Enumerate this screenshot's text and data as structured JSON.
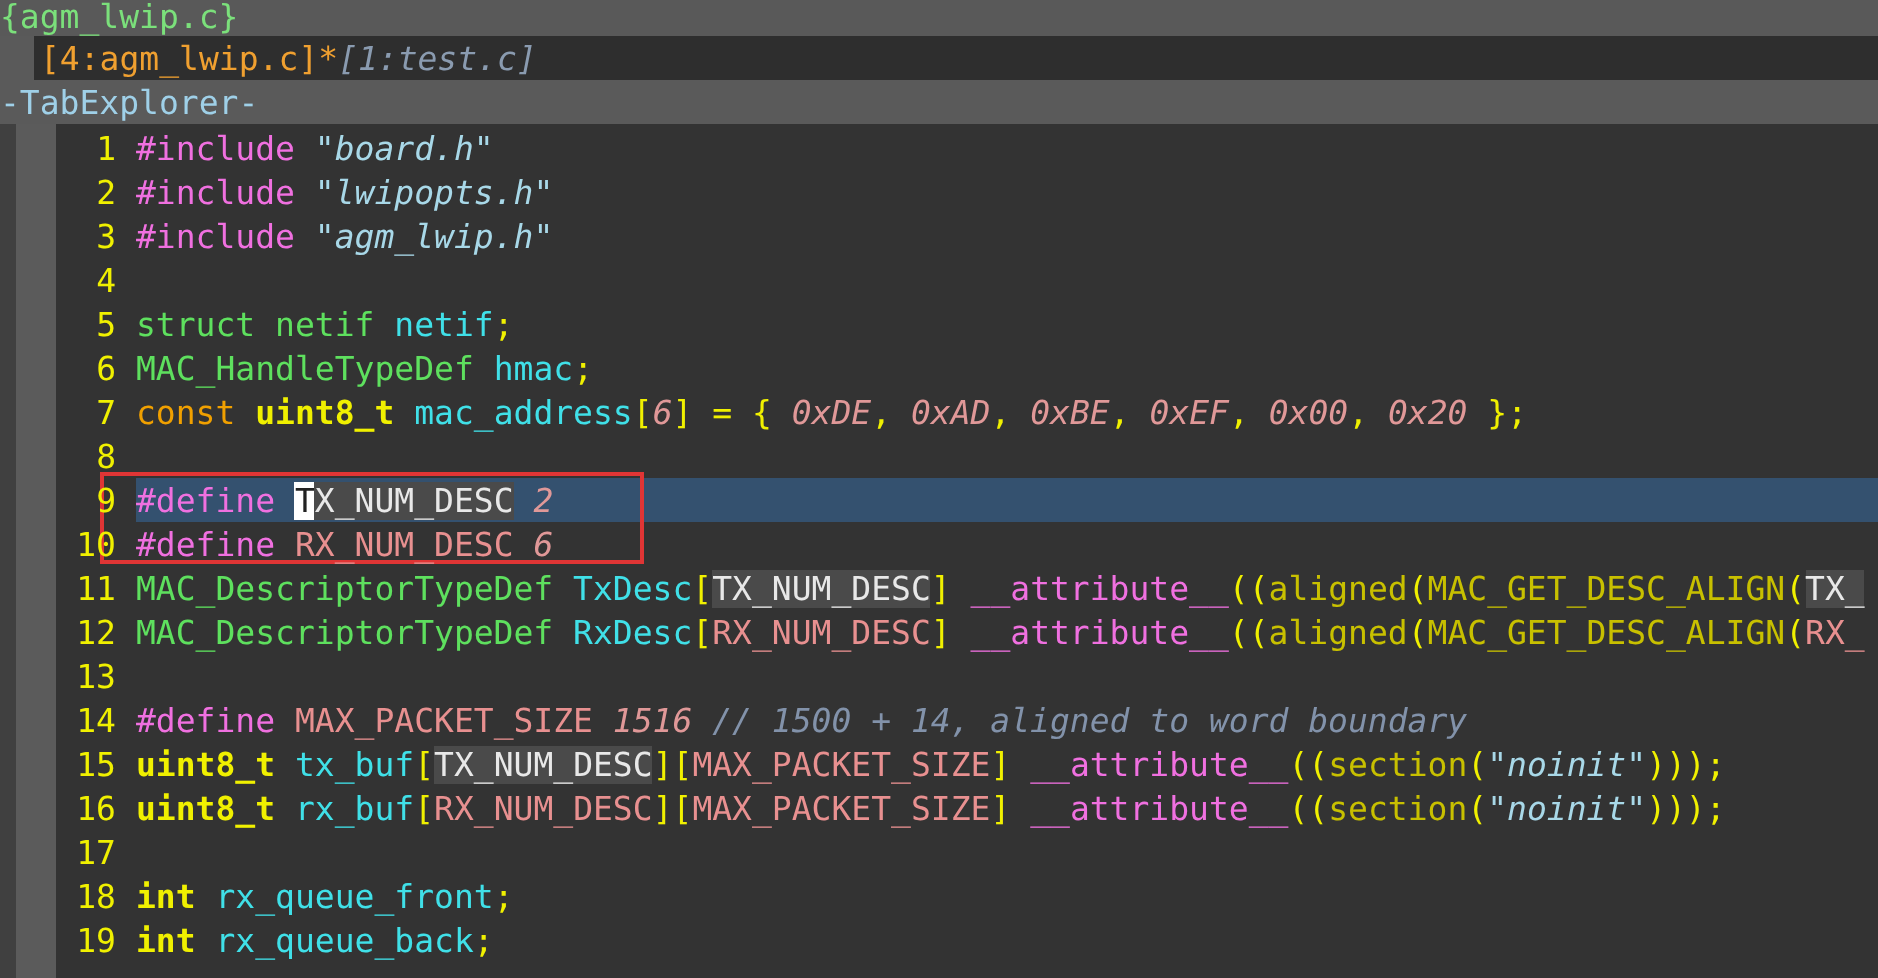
{
  "header": {
    "title": "{agm_lwip.c}"
  },
  "tabs": [
    {
      "label": "[4:agm_lwip.c]",
      "selected": true,
      "modified_mark": "*"
    },
    {
      "label": "[1:test.c]",
      "selected": false
    }
  ],
  "explorer": {
    "title": "-TabExplorer-"
  },
  "editor": {
    "lines": [
      {
        "number": "1",
        "current": false,
        "tokens": [
          {
            "text": "#include",
            "kind": "preproc"
          },
          {
            "text": " \"board.h\"",
            "kind": "string"
          }
        ]
      },
      {
        "number": "2",
        "current": false,
        "tokens": [
          {
            "text": "#include",
            "kind": "preproc"
          },
          {
            "text": " \"lwipopts.h\"",
            "kind": "string"
          }
        ]
      },
      {
        "number": "3",
        "current": false,
        "tokens": [
          {
            "text": "#include",
            "kind": "preproc"
          },
          {
            "text": " \"agm_lwip.h\"",
            "kind": "string"
          }
        ]
      },
      {
        "number": "4",
        "current": false
      },
      {
        "number": "5",
        "current": false,
        "tokens": [
          {
            "text": "struct netif",
            "kind": "type"
          },
          {
            "text": " netif",
            "kind": "ident"
          },
          {
            "text": ";",
            "kind": "punct"
          }
        ]
      },
      {
        "number": "6",
        "current": false,
        "tokens": [
          {
            "text": "MAC_HandleTypeDef",
            "kind": "type"
          },
          {
            "text": " hmac",
            "kind": "ident"
          },
          {
            "text": ";",
            "kind": "punct"
          }
        ]
      },
      {
        "number": "7",
        "current": false,
        "tokens": [
          {
            "text": "const",
            "kind": "keyword"
          },
          {
            "text": " uint8_t",
            "kind": "builtin"
          },
          {
            "text": " mac_address",
            "kind": "ident"
          },
          {
            "text": "[",
            "kind": "punct"
          },
          {
            "text": "6",
            "kind": "number"
          },
          {
            "text": "] = { ",
            "kind": "punct"
          },
          {
            "text": "0xDE",
            "kind": "number"
          },
          {
            "text": ", ",
            "kind": "punct"
          },
          {
            "text": "0xAD",
            "kind": "number"
          },
          {
            "text": ", ",
            "kind": "punct"
          },
          {
            "text": "0xBE",
            "kind": "number"
          },
          {
            "text": ", ",
            "kind": "punct"
          },
          {
            "text": "0xEF",
            "kind": "number"
          },
          {
            "text": ", ",
            "kind": "punct"
          },
          {
            "text": "0x00",
            "kind": "number"
          },
          {
            "text": ", ",
            "kind": "punct"
          },
          {
            "text": "0x20",
            "kind": "number"
          },
          {
            "text": " };",
            "kind": "punct"
          }
        ]
      },
      {
        "number": "8",
        "current": false
      },
      {
        "number": "9",
        "current": true,
        "tokens": [
          {
            "text": "#define ",
            "kind": "preproc"
          },
          {
            "text": "T",
            "kind": "cursor"
          },
          {
            "text": "X_NUM_DESC",
            "kind": "match"
          },
          {
            "text": " 2",
            "kind": "number"
          }
        ]
      },
      {
        "number": "10",
        "current": false,
        "tokens": [
          {
            "text": "#define",
            "kind": "preproc"
          },
          {
            "text": " RX_NUM_DESC",
            "kind": "macro"
          },
          {
            "text": " 6",
            "kind": "number"
          }
        ]
      },
      {
        "number": "11",
        "current": false,
        "tokens": [
          {
            "text": "MAC_DescriptorTypeDef",
            "kind": "type"
          },
          {
            "text": " TxDesc",
            "kind": "ident"
          },
          {
            "text": "[",
            "kind": "punct"
          },
          {
            "text": "TX_NUM_DESC",
            "kind": "match"
          },
          {
            "text": "]",
            "kind": "punct"
          },
          {
            "text": " __attribute__",
            "kind": "preproc"
          },
          {
            "text": "((",
            "kind": "punct"
          },
          {
            "text": "aligned",
            "kind": "func"
          },
          {
            "text": "(",
            "kind": "punct"
          },
          {
            "text": "MAC_GET_DESC_ALIGN",
            "kind": "func"
          },
          {
            "text": "(",
            "kind": "punct"
          },
          {
            "text": "TX_",
            "kind": "match"
          }
        ]
      },
      {
        "number": "12",
        "current": false,
        "tokens": [
          {
            "text": "MAC_DescriptorTypeDef",
            "kind": "type"
          },
          {
            "text": " RxDesc",
            "kind": "ident"
          },
          {
            "text": "[",
            "kind": "punct"
          },
          {
            "text": "RX_NUM_DESC",
            "kind": "macro"
          },
          {
            "text": "]",
            "kind": "punct"
          },
          {
            "text": " __attribute__",
            "kind": "preproc"
          },
          {
            "text": "((",
            "kind": "punct"
          },
          {
            "text": "aligned",
            "kind": "func"
          },
          {
            "text": "(",
            "kind": "punct"
          },
          {
            "text": "MAC_GET_DESC_ALIGN",
            "kind": "func"
          },
          {
            "text": "(",
            "kind": "punct"
          },
          {
            "text": "RX_",
            "kind": "macro"
          }
        ]
      },
      {
        "number": "13",
        "current": false
      },
      {
        "number": "14",
        "current": false,
        "tokens": [
          {
            "text": "#define",
            "kind": "preproc"
          },
          {
            "text": " MAX_PACKET_SIZE",
            "kind": "macro"
          },
          {
            "text": " 1516",
            "kind": "number"
          },
          {
            "text": " // 1500 + 14, aligned to word boundary",
            "kind": "comment"
          }
        ]
      },
      {
        "number": "15",
        "current": false,
        "tokens": [
          {
            "text": "uint8_t",
            "kind": "builtin"
          },
          {
            "text": " tx_buf",
            "kind": "ident"
          },
          {
            "text": "[",
            "kind": "punct"
          },
          {
            "text": "TX_NUM_DESC",
            "kind": "match"
          },
          {
            "text": "][",
            "kind": "punct"
          },
          {
            "text": "MAX_PACKET_SIZE",
            "kind": "macro"
          },
          {
            "text": "]",
            "kind": "punct"
          },
          {
            "text": " __attribute__",
            "kind": "preproc"
          },
          {
            "text": "((",
            "kind": "punct"
          },
          {
            "text": "section",
            "kind": "func"
          },
          {
            "text": "(",
            "kind": "punct"
          },
          {
            "text": "\"noinit\"",
            "kind": "string"
          },
          {
            "text": ")));",
            "kind": "punct"
          }
        ]
      },
      {
        "number": "16",
        "current": false,
        "tokens": [
          {
            "text": "uint8_t",
            "kind": "builtin"
          },
          {
            "text": " rx_buf",
            "kind": "ident"
          },
          {
            "text": "[",
            "kind": "punct"
          },
          {
            "text": "RX_NUM_DESC",
            "kind": "macro"
          },
          {
            "text": "][",
            "kind": "punct"
          },
          {
            "text": "MAX_PACKET_SIZE",
            "kind": "macro"
          },
          {
            "text": "]",
            "kind": "punct"
          },
          {
            "text": " __attribute__",
            "kind": "preproc"
          },
          {
            "text": "((",
            "kind": "punct"
          },
          {
            "text": "section",
            "kind": "func"
          },
          {
            "text": "(",
            "kind": "punct"
          },
          {
            "text": "\"noinit\"",
            "kind": "string"
          },
          {
            "text": ")));",
            "kind": "punct"
          }
        ]
      },
      {
        "number": "17",
        "current": false
      },
      {
        "number": "18",
        "current": false,
        "tokens": [
          {
            "text": "int",
            "kind": "builtin"
          },
          {
            "text": " rx_queue_front",
            "kind": "ident"
          },
          {
            "text": ";",
            "kind": "punct"
          }
        ]
      },
      {
        "number": "19",
        "current": false,
        "tokens": [
          {
            "text": "int",
            "kind": "builtin"
          },
          {
            "text": " rx_queue_back",
            "kind": "ident"
          },
          {
            "text": ";",
            "kind": "punct"
          }
        ]
      }
    ]
  }
}
